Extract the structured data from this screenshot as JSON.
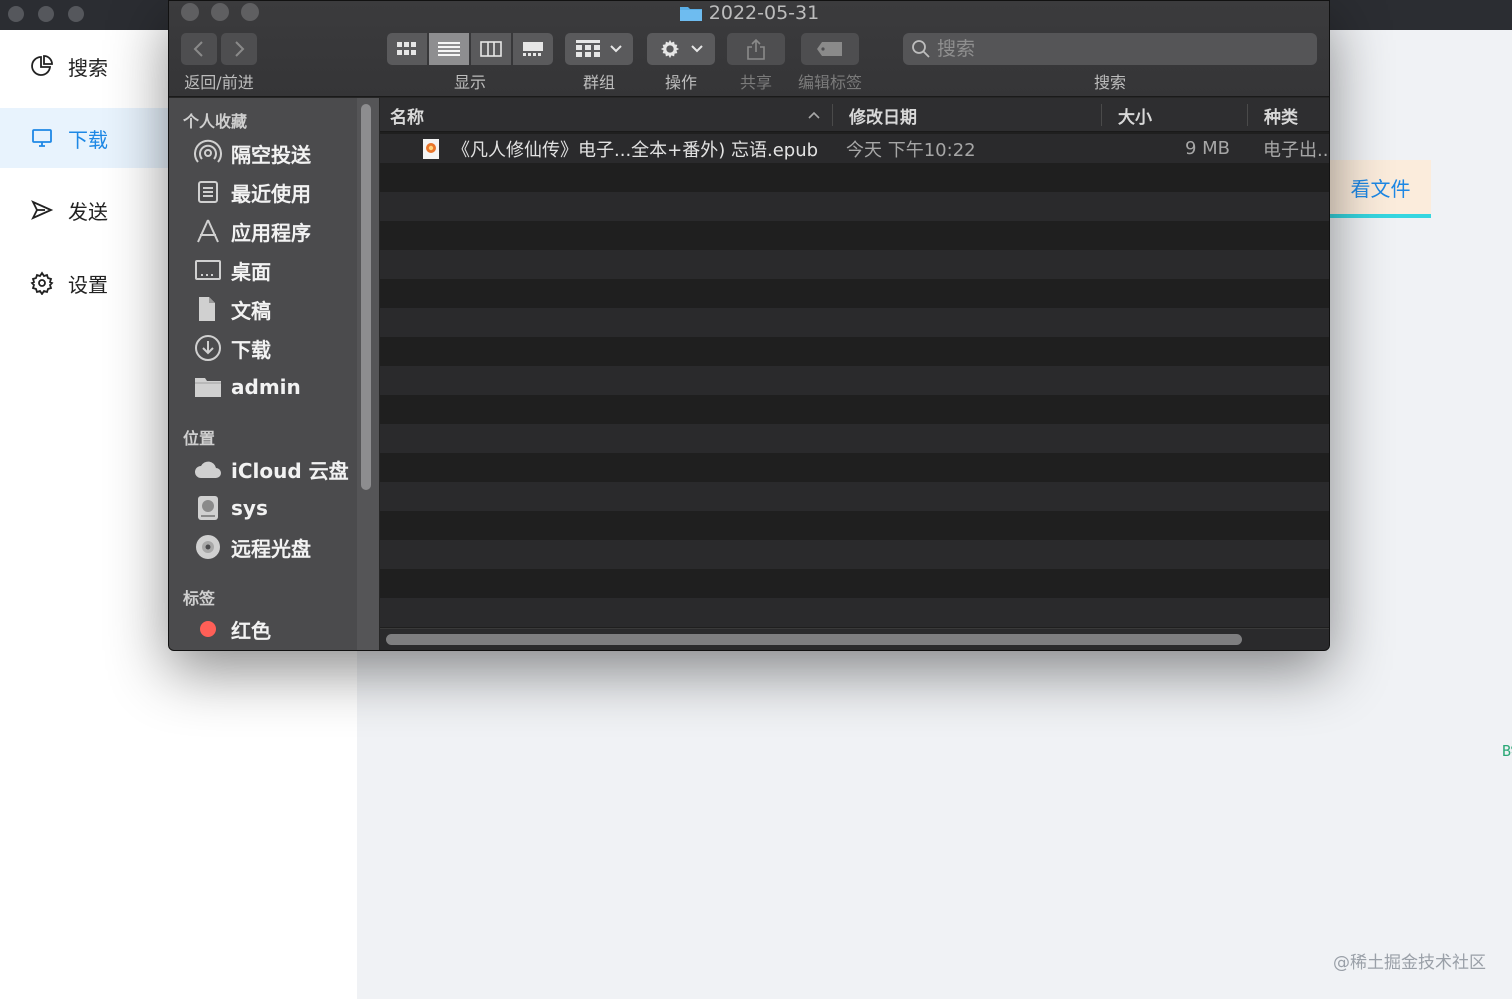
{
  "background_app": {
    "nav": [
      {
        "label": "搜索",
        "icon": "pie-chart-icon"
      },
      {
        "label": "下载",
        "icon": "monitor-icon",
        "active": true
      },
      {
        "label": "发送",
        "icon": "send-icon"
      },
      {
        "label": "设置",
        "icon": "gear-icon"
      }
    ],
    "open_file_label": "看文件",
    "watermark": "@稀土掘金技术社区",
    "edge_code": "B%d",
    "colors": {
      "accent": "#1e88e5",
      "active_bg": "#e8f3fd"
    }
  },
  "finder": {
    "title": "2022-05-31",
    "toolbar": {
      "back_forward_label": "返回/前进",
      "view_label": "显示",
      "group_label": "群组",
      "action_label": "操作",
      "share_label": "共享",
      "tags_label": "编辑标签",
      "search_label": "搜索",
      "search_placeholder": "搜索"
    },
    "sidebar": {
      "favorites_title": "个人收藏",
      "favorites": [
        {
          "label": "隔空投送",
          "icon": "airdrop-icon"
        },
        {
          "label": "最近使用",
          "icon": "recents-icon"
        },
        {
          "label": "应用程序",
          "icon": "applications-icon"
        },
        {
          "label": "桌面",
          "icon": "desktop-icon"
        },
        {
          "label": "文稿",
          "icon": "documents-icon"
        },
        {
          "label": "下载",
          "icon": "download-icon"
        },
        {
          "label": "admin",
          "icon": "folder-icon"
        }
      ],
      "locations_title": "位置",
      "locations": [
        {
          "label": "iCloud 云盘",
          "icon": "cloud-icon"
        },
        {
          "label": "sys",
          "icon": "disk-icon"
        },
        {
          "label": "远程光盘",
          "icon": "optical-disc-icon"
        }
      ],
      "tags_title": "标签",
      "tags": [
        {
          "label": "红色",
          "color": "#ff5f57"
        }
      ]
    },
    "columns": {
      "name": "名称",
      "date": "修改日期",
      "size": "大小",
      "kind": "种类"
    },
    "files": [
      {
        "name": "《凡人修仙传》电子...全本+番外) 忘语.epub",
        "date": "今天 下午10:22",
        "size": "9 MB",
        "kind": "电子出..."
      }
    ]
  }
}
